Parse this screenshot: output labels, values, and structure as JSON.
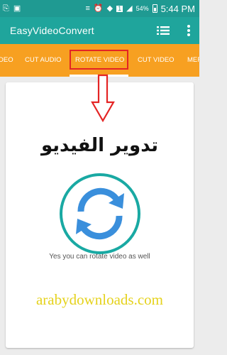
{
  "status_bar": {
    "battery": "54%",
    "time": "5:44 PM",
    "sim": "1"
  },
  "app_bar": {
    "title": "EasyVideoConvert",
    "list_icon": "list-icon",
    "more_icon": "more-vert-icon"
  },
  "tabs": [
    {
      "label": "DEO"
    },
    {
      "label": "CUT AUDIO"
    },
    {
      "label": "ROTATE VIDEO",
      "selected": true
    },
    {
      "label": "CUT VIDEO"
    },
    {
      "label": "MER"
    }
  ],
  "card": {
    "arabic_title": "تدوير الفيديو",
    "caption": "Yes you can rotate video as well",
    "watermark": "arabydownloads.com",
    "icon": "rotate-icon"
  },
  "colors": {
    "status_bar": "#1f9a92",
    "app_bar": "#1fa59c",
    "tab_bar": "#f7a021",
    "highlight": "#e42424",
    "icon_ring": "#19a9a3",
    "icon_arrows": "#3a8fdc",
    "watermark": "#e5d21c"
  }
}
